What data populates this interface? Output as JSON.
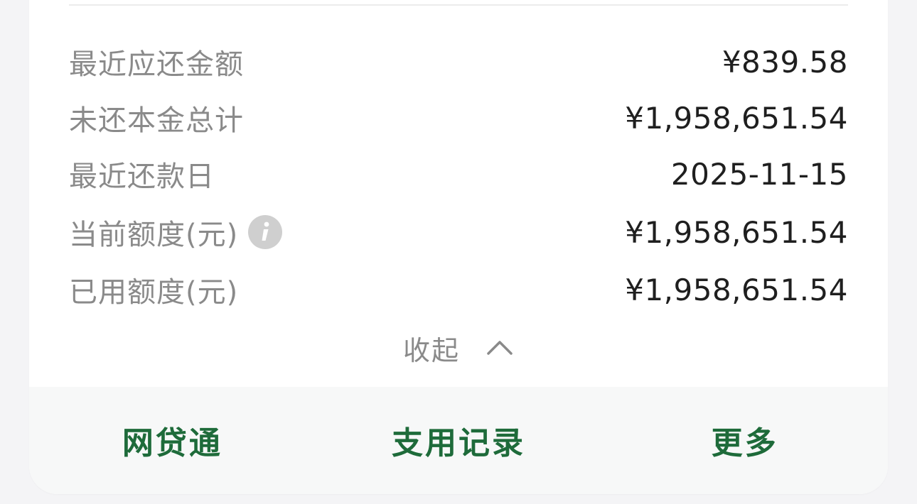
{
  "summary": {
    "rows": [
      {
        "label": "最近应还金额",
        "value": "¥839.58"
      },
      {
        "label": "未还本金总计",
        "value": "¥1,958,651.54"
      },
      {
        "label": "最近还款日",
        "value": "2025-11-15"
      },
      {
        "label": "当前额度(元)",
        "value": "¥1,958,651.54",
        "icon": "info-icon"
      },
      {
        "label": "已用额度(元)",
        "value": "¥1,958,651.54"
      }
    ],
    "collapse_label": "收起"
  },
  "bottom_actions": [
    {
      "label": "网贷通"
    },
    {
      "label": "支用记录"
    },
    {
      "label": "更多"
    }
  ],
  "colors": {
    "accent_green": "#1e6b3a",
    "label_gray": "#8a8a8a",
    "value_dark": "#1f1f1f",
    "icon_gray": "#cfcfcf"
  }
}
